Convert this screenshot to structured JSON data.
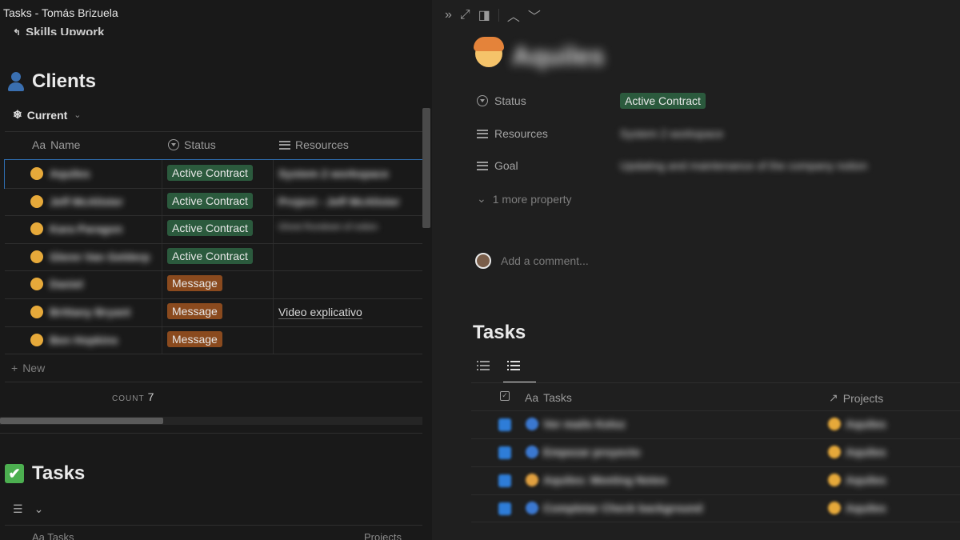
{
  "window_title": "Tasks - Tomás Brizuela",
  "left": {
    "parent_link": "Skills Upwork",
    "clients_title": "Clients",
    "view_tab": "Current",
    "columns": {
      "name": "Name",
      "status": "Status",
      "resources": "Resources"
    },
    "name_icon": "Aa",
    "rows": [
      {
        "name": "Aquiles",
        "status": "Active Contract",
        "status_color": "#2b5a3d",
        "resource": "System 2 workspace"
      },
      {
        "name": "Jeff McAlister",
        "status": "Active Contract",
        "status_color": "#2b5a3d",
        "resource": "Project - Jeff McAlister"
      },
      {
        "name": "Kara Paragon",
        "status": "Active Contract",
        "status_color": "#2b5a3d",
        "resource": "Ghost Rundown of notion"
      },
      {
        "name": "Glenn Van Gelderp",
        "status": "Active Contract",
        "status_color": "#2b5a3d",
        "resource": ""
      },
      {
        "name": "Daniel",
        "status": "Message",
        "status_color": "#8a4a1e",
        "resource": ""
      },
      {
        "name": "Brittany Bryant",
        "status": "Message",
        "status_color": "#8a4a1e",
        "resource": "Video explicativo"
      },
      {
        "name": "Ben Hopkins",
        "status": "Message",
        "status_color": "#8a4a1e",
        "resource": ""
      }
    ],
    "new_label": "New",
    "count_label": "COUNT",
    "count_value": "7",
    "tasks_title": "Tasks",
    "tasks_cols": {
      "tasks": "Aa Tasks",
      "projects": "Projects"
    }
  },
  "right": {
    "page_title": "Aquiles",
    "properties": [
      {
        "label": "Status",
        "value": "Active Contract",
        "icon": "status-icon"
      },
      {
        "label": "Resources",
        "value": "System 2 workspace",
        "icon": "lines-icon"
      },
      {
        "label": "Goal",
        "value": "Updating and maintenance of the company notion",
        "icon": "lines-icon"
      }
    ],
    "more_property": "1 more property",
    "comment_placeholder": "Add a comment...",
    "tasks_title": "Tasks",
    "tasks_columns": {
      "tasks": "Tasks",
      "projects": "Projects"
    },
    "tasks_rows": [
      {
        "name": "Ver mails Keloz",
        "project": "Aquiles",
        "icon_color": "#3b78d0"
      },
      {
        "name": "Empezar proyecto",
        "project": "Aquiles",
        "icon_color": "#3b78d0"
      },
      {
        "name": "Aquiles: Meeting Notes",
        "project": "Aquiles",
        "icon_color": "#e0a040"
      },
      {
        "name": "Completar Check background",
        "project": "Aquiles",
        "icon_color": "#3b78d0"
      }
    ]
  },
  "colors": {
    "accent_blue": "#2f6db0",
    "tag_green": "#2b5a3d",
    "tag_orange": "#8a4a1e"
  }
}
